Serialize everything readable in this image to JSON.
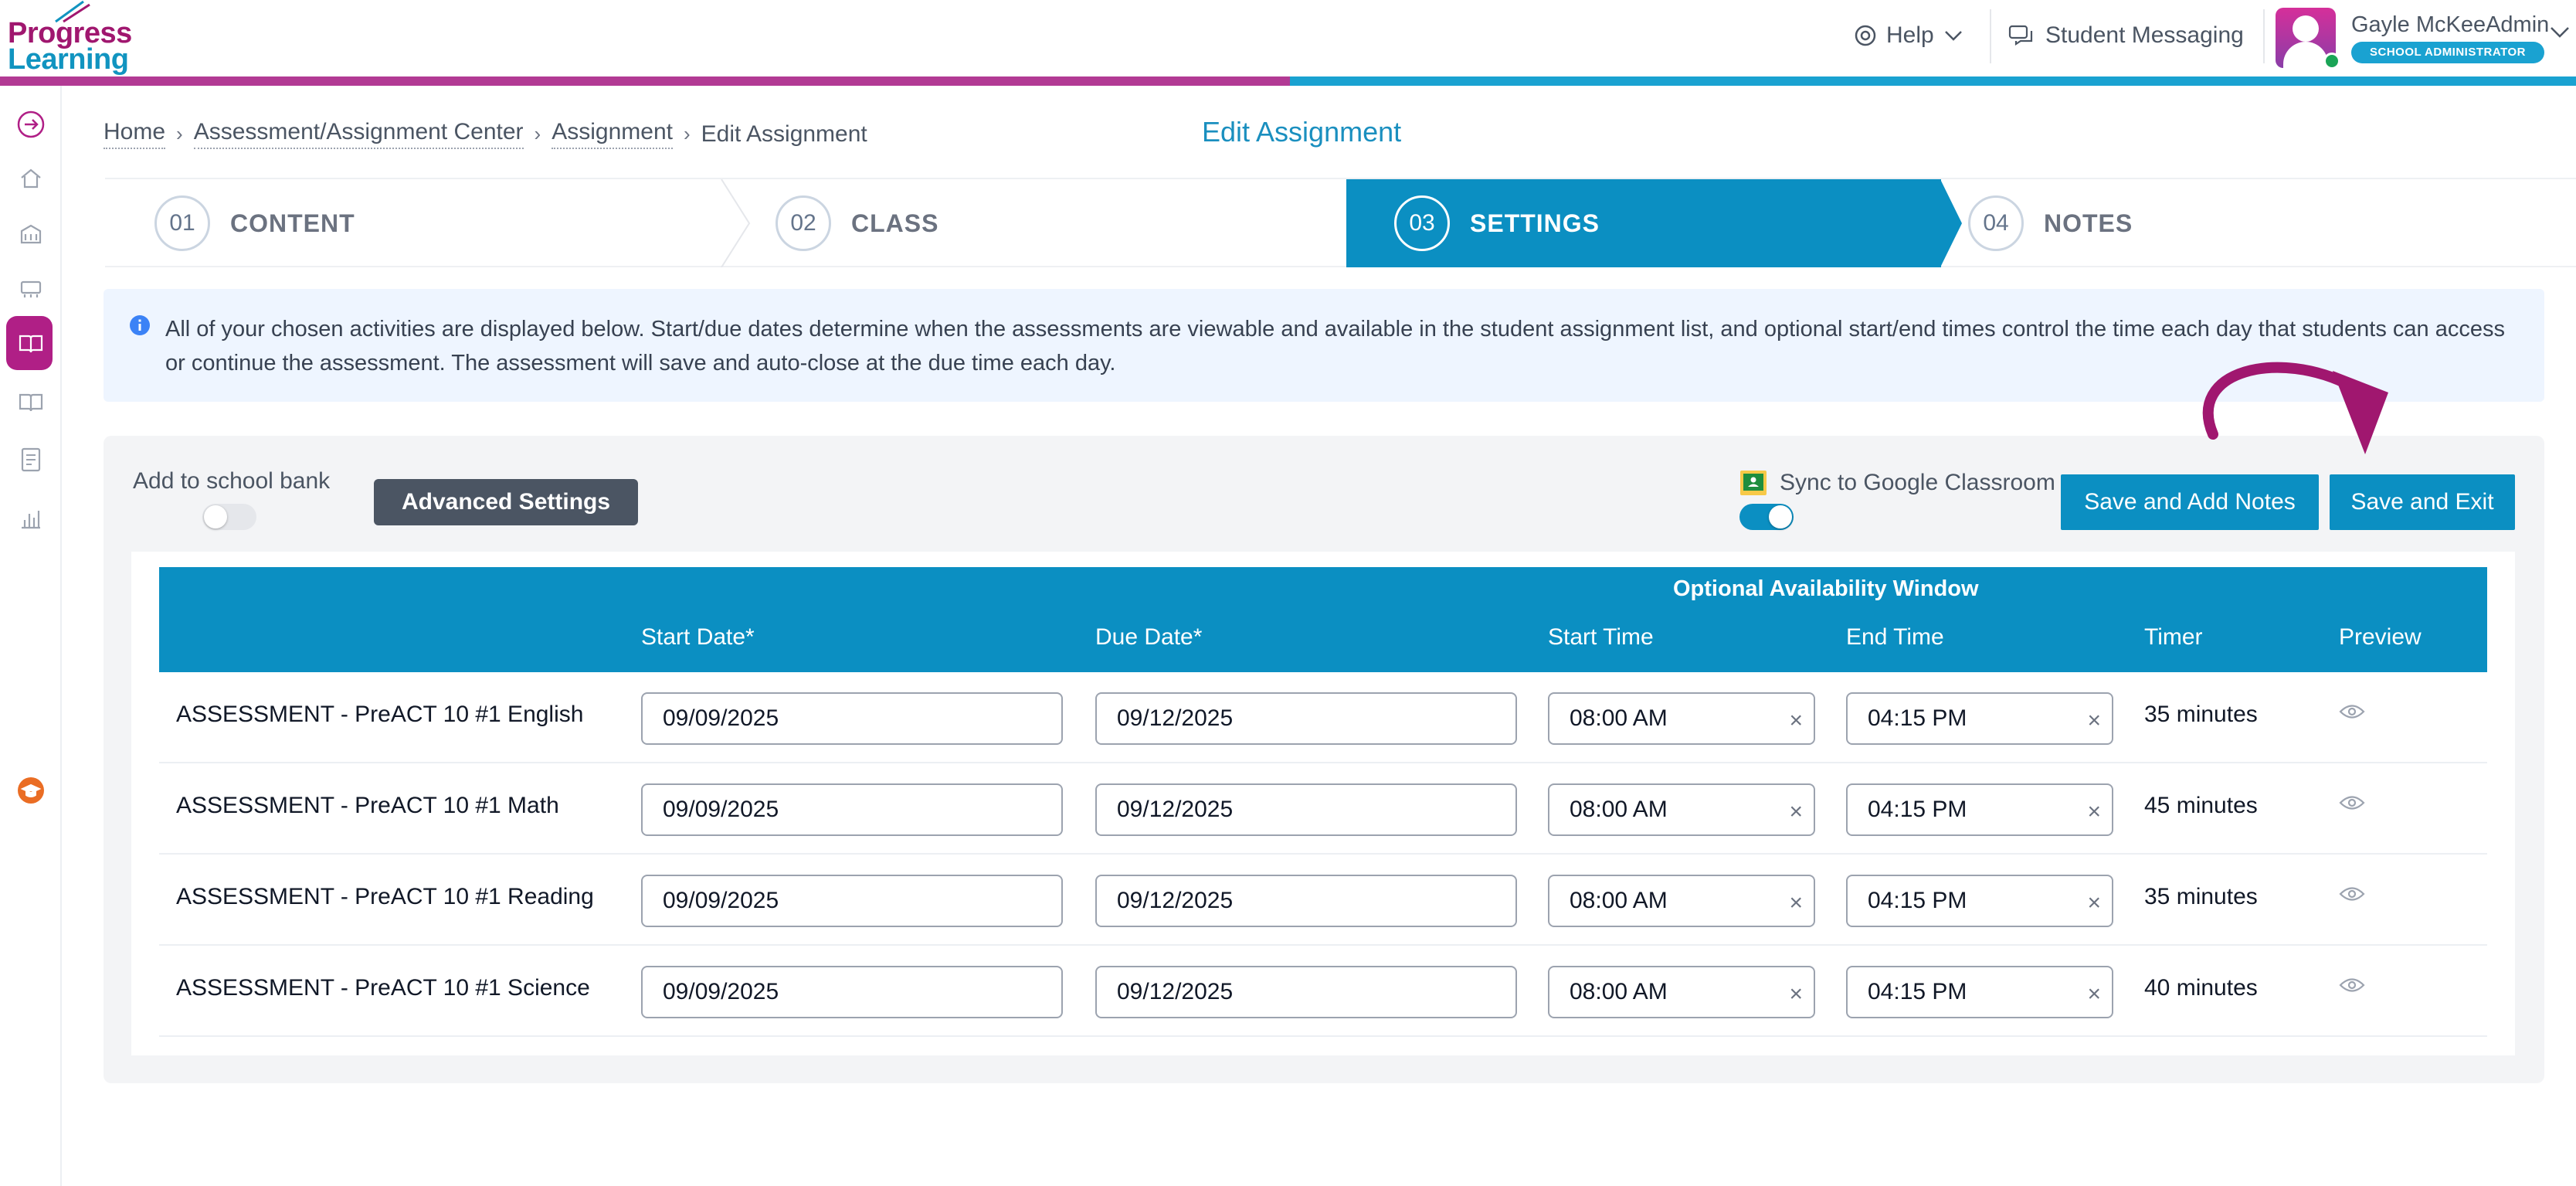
{
  "app": {
    "brand_line1": "Progress",
    "brand_line2": "Learning",
    "accent_purple": "#b23a94",
    "accent_blue": "#1aa2d1"
  },
  "header": {
    "help_label": "Help",
    "messaging_label": "Student Messaging",
    "user_name": "Gayle McKeeAdmin",
    "user_role": "SCHOOL ADMINISTRATOR"
  },
  "breadcrumb": {
    "items": [
      "Home",
      "Assessment/Assignment Center",
      "Assignment",
      "Edit Assignment"
    ]
  },
  "page_title": "Edit Assignment",
  "steps": [
    {
      "num": "01",
      "label": "CONTENT",
      "active": false
    },
    {
      "num": "02",
      "label": "CLASS",
      "active": false
    },
    {
      "num": "03",
      "label": "SETTINGS",
      "active": true
    },
    {
      "num": "04",
      "label": "NOTES",
      "active": false
    }
  ],
  "info_text": "All of your chosen activities are displayed below. Start/due dates determine when the assessments are viewable and available in the student assignment list, and optional start/end times control the time each day that students can access or continue the assessment. The assessment will save and auto-close at the due time each day.",
  "settings": {
    "school_bank_label": "Add to school bank",
    "school_bank_on": false,
    "advanced_label": "Advanced Settings",
    "sync_label": "Sync to Google Classroom",
    "sync_on": true,
    "save_notes_label": "Save and Add Notes",
    "save_exit_label": "Save and Exit"
  },
  "table": {
    "group_header": "Optional Availability Window",
    "headers": [
      "Start Date*",
      "Due Date*",
      "Start Time",
      "End Time",
      "Timer",
      "Preview"
    ],
    "rows": [
      {
        "name": "ASSESSMENT - PreACT 10 #1 English",
        "start_date": "09/09/2025",
        "due_date": "09/12/2025",
        "start_time": "08:00 AM",
        "end_time": "04:15 PM",
        "timer": "35 minutes"
      },
      {
        "name": "ASSESSMENT - PreACT 10 #1 Math",
        "start_date": "09/09/2025",
        "due_date": "09/12/2025",
        "start_time": "08:00 AM",
        "end_time": "04:15 PM",
        "timer": "45 minutes"
      },
      {
        "name": "ASSESSMENT - PreACT 10 #1 Reading",
        "start_date": "09/09/2025",
        "due_date": "09/12/2025",
        "start_time": "08:00 AM",
        "end_time": "04:15 PM",
        "timer": "35 minutes"
      },
      {
        "name": "ASSESSMENT - PreACT 10 #1 Science",
        "start_date": "09/09/2025",
        "due_date": "09/12/2025",
        "start_time": "08:00 AM",
        "end_time": "04:15 PM",
        "timer": "40 minutes"
      }
    ]
  }
}
